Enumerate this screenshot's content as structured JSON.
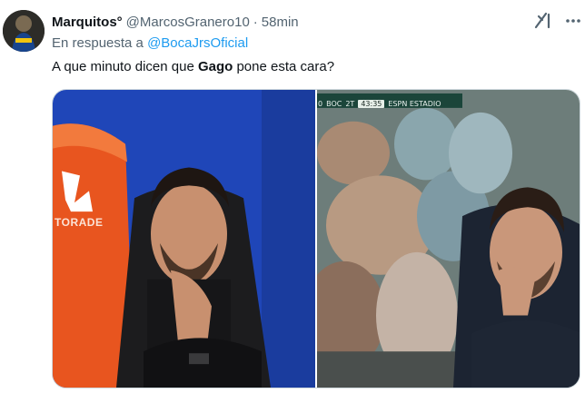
{
  "author": {
    "name": "Marquitos",
    "badge": "°",
    "handle": "@MarcosGranero10",
    "separator": "·",
    "time": "58min"
  },
  "reply": {
    "prefix": "En respuesta a",
    "mention": "@BocaJrsOficial"
  },
  "tweet": {
    "before": "A que minuto dicen que ",
    "bold": "Gago",
    "after": " pone esta cara?"
  },
  "media": {
    "left_photo": {
      "brand_text": "TORADE"
    },
    "right_photo": {
      "scorebug": {
        "home_score": "0",
        "home_team": "BOC",
        "half": "2T",
        "clock": "43:35",
        "extra": "ESPN ESTADIO"
      }
    }
  },
  "colors": {
    "mention": "#1d9bf0",
    "secondary_text": "#536471",
    "border": "#cfd9de"
  },
  "icons": [
    "avatar",
    "grok-icon",
    "more-icon"
  ]
}
